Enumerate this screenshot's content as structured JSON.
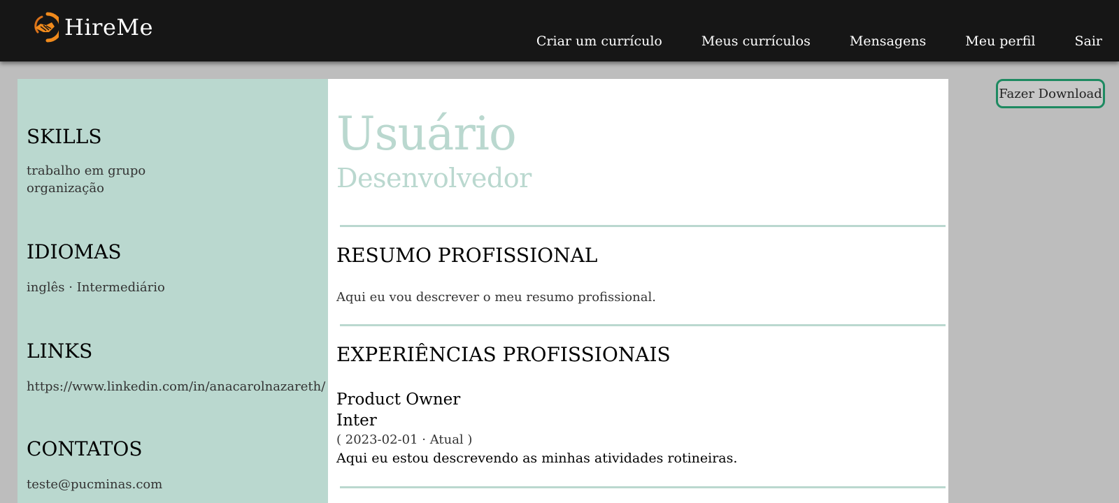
{
  "header": {
    "brand": "HireMe",
    "logo_icon": "handshake-icon",
    "nav": [
      {
        "label": "Criar um currículo"
      },
      {
        "label": "Meus currículos"
      },
      {
        "label": "Mensagens"
      },
      {
        "label": "Meu perfil"
      },
      {
        "label": "Sair"
      }
    ]
  },
  "actions": {
    "download_label": "Fazer Download"
  },
  "resume": {
    "name": "Usuário",
    "role": "Desenvolvedor",
    "sidebar": {
      "skills": {
        "heading": "SKILLS",
        "items": [
          "trabalho em grupo",
          "organização"
        ]
      },
      "idiomas": {
        "heading": "IDIOMAS",
        "items": [
          "inglês · Intermediário"
        ]
      },
      "links": {
        "heading": "LINKS",
        "items": [
          "https://www.linkedin.com/in/anacarolnazareth/"
        ]
      },
      "contatos": {
        "heading": "CONTATOS",
        "items": [
          "teste@pucminas.com"
        ]
      }
    },
    "resumo": {
      "heading": "RESUMO PROFISSIONAL",
      "text": "Aqui eu vou descrever o meu resumo profissional."
    },
    "experiencias": {
      "heading": "EXPERIÊNCIAS PROFISSIONAIS",
      "items": [
        {
          "title": "Product Owner",
          "company": "Inter",
          "dates": "( 2023-02-01 · Atual )",
          "description": "Aqui eu estou descrevendo as minhas atividades rotineiras."
        }
      ]
    }
  },
  "colors": {
    "header_bg": "#161616",
    "accent": "#bad8cf",
    "logo_orange": "#f08a1c",
    "button_border": "#1e8a61",
    "page_bg": "#bdbdbd"
  }
}
